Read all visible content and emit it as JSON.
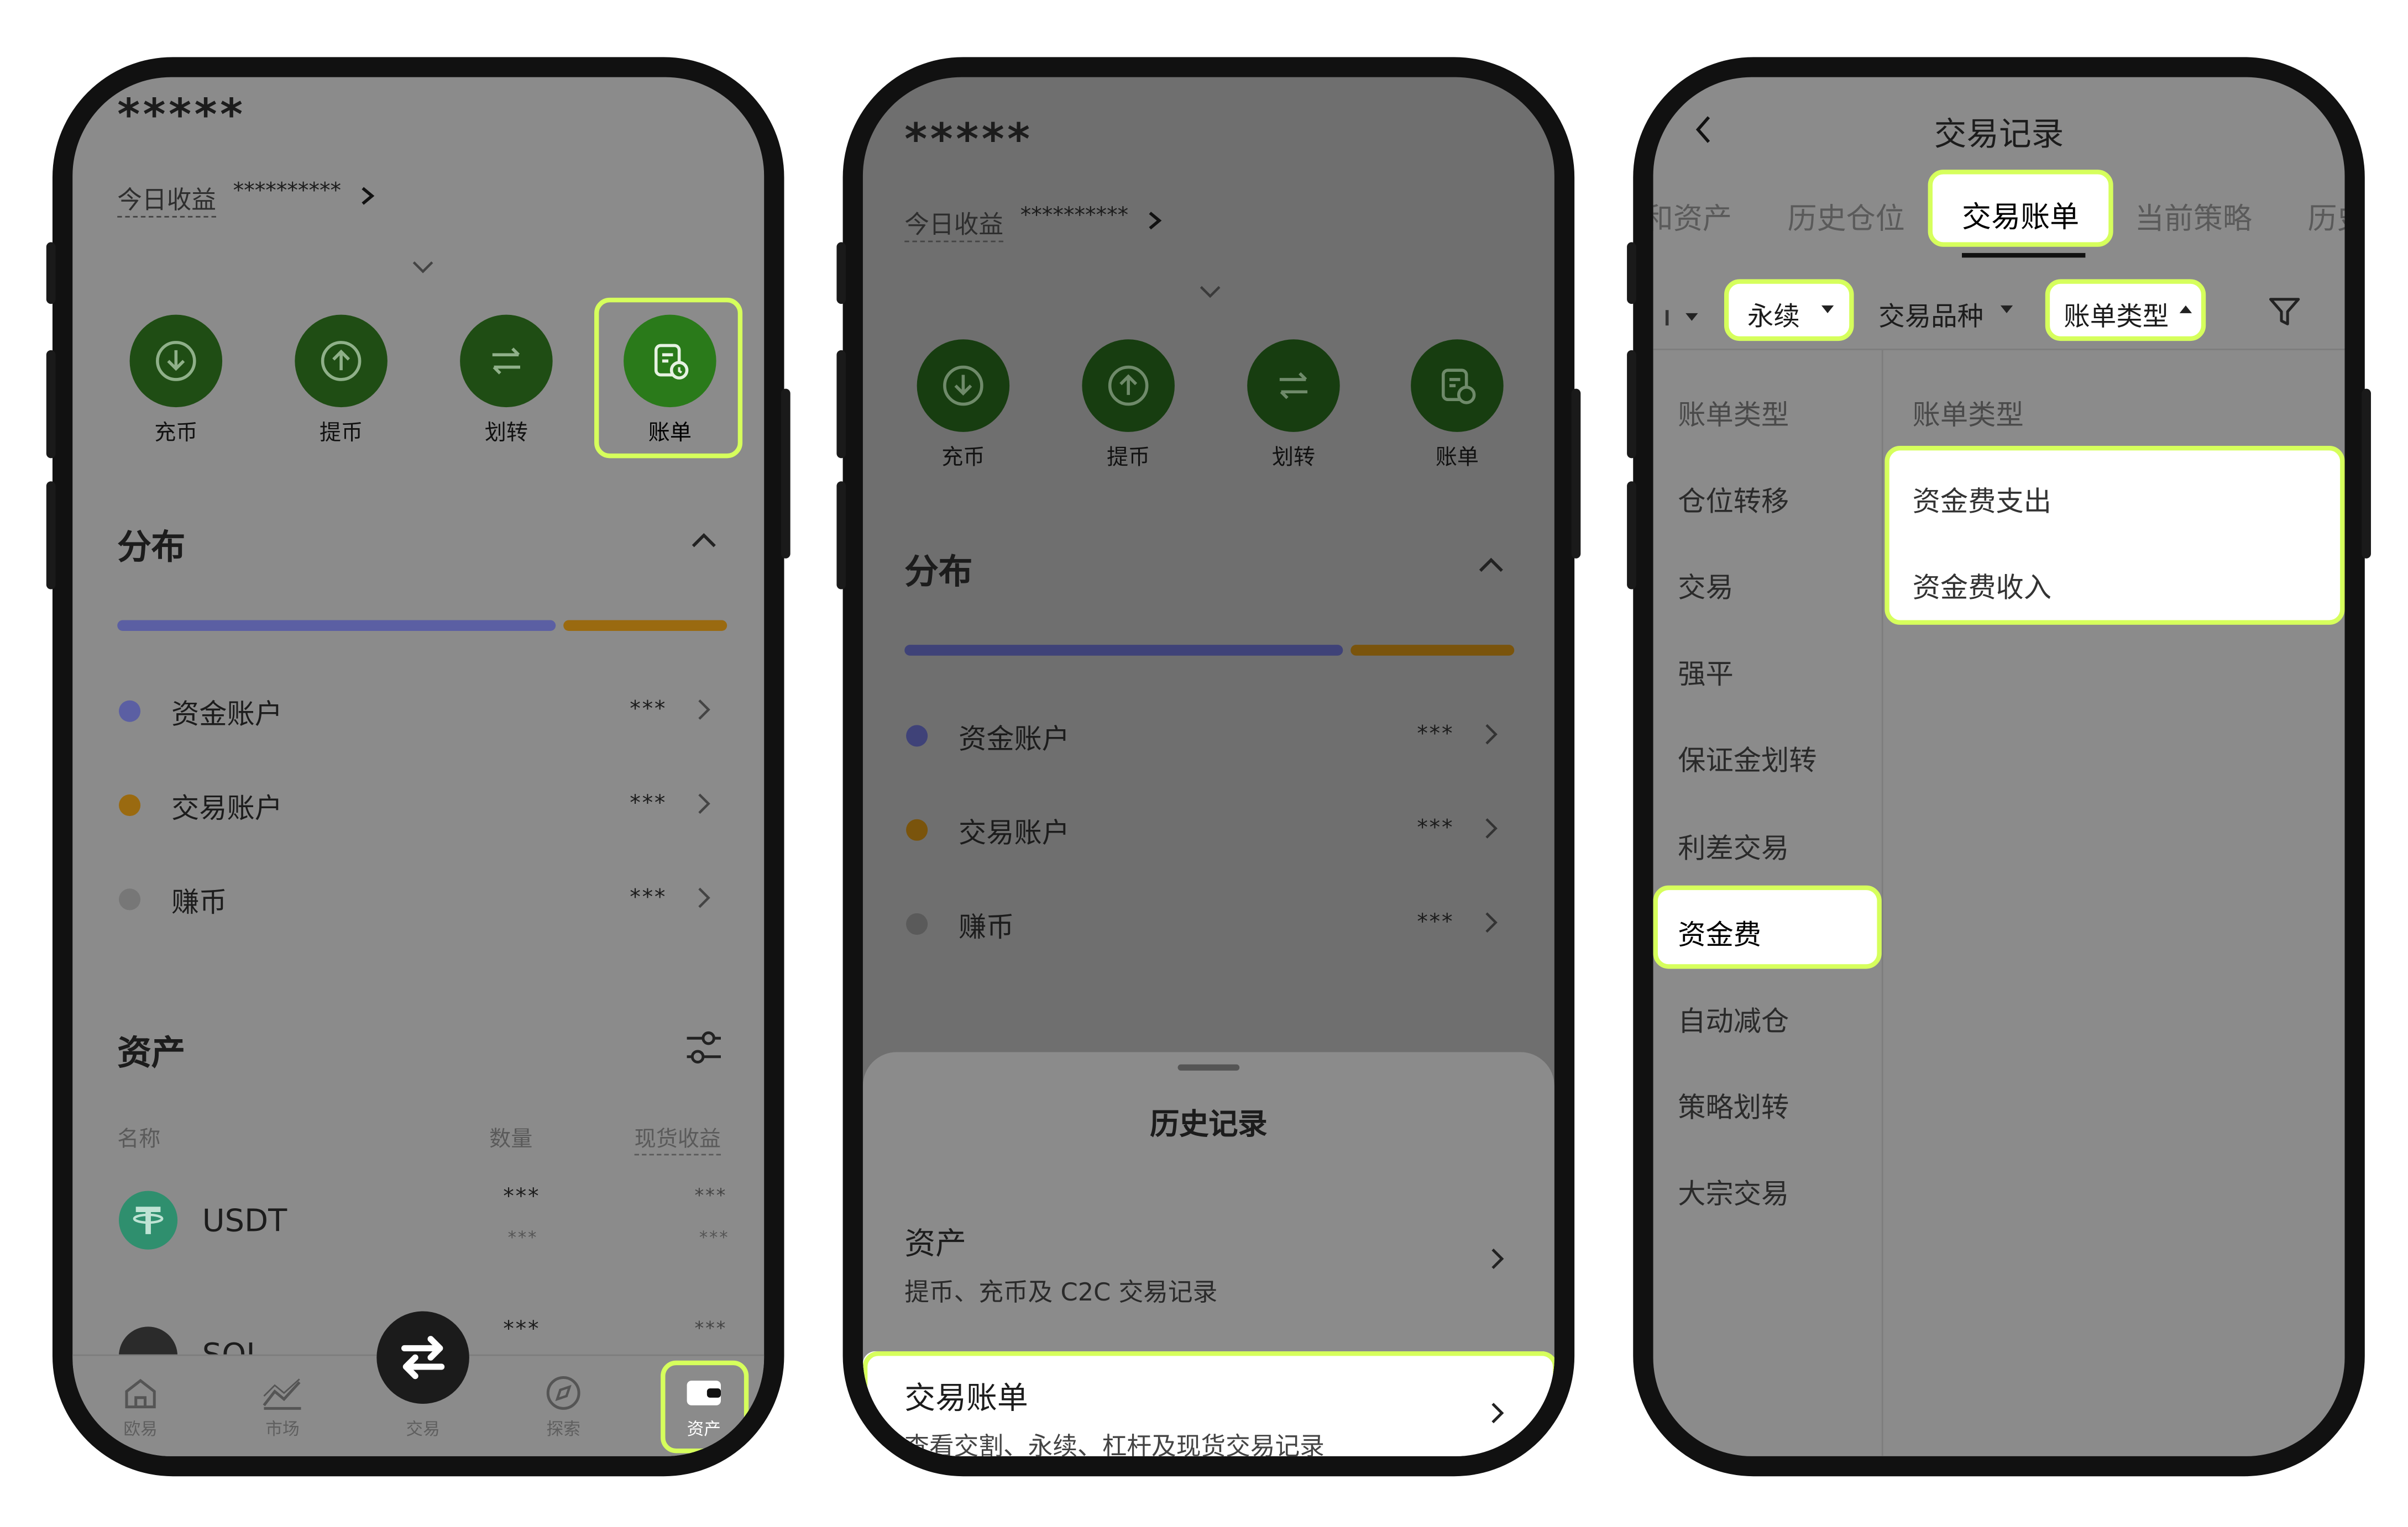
{
  "colors": {
    "highlight": "#d6ff5c",
    "screen_gray": "#8b8b8b",
    "action_green": "#1f4d14",
    "funding_account": "#5b5fa3",
    "trading_account": "#9a6a10",
    "earn": "#777777",
    "usdt_green": "#2f8f6e"
  },
  "phone1": {
    "balance_mask": "*****",
    "today_pnl_label": "今日收益",
    "today_pnl_value": "**********",
    "actions": [
      {
        "label": "充币",
        "icon": "deposit-icon"
      },
      {
        "label": "提币",
        "icon": "withdraw-icon"
      },
      {
        "label": "划转",
        "icon": "transfer-icon"
      },
      {
        "label": "账单",
        "icon": "bill-icon"
      }
    ],
    "distribution_title": "分布",
    "accounts": [
      {
        "name": "资金账户",
        "value": "***"
      },
      {
        "name": "交易账户",
        "value": "***"
      },
      {
        "name": "赚币",
        "value": "***"
      }
    ],
    "assets_title": "资产",
    "columns": {
      "name": "名称",
      "quantity": "数量",
      "pnl": "现货收益"
    },
    "coins": [
      {
        "symbol": "USDT",
        "qty": "***",
        "qty_sub": "***",
        "pnl": "***",
        "pnl_sub": "***"
      },
      {
        "symbol": "SOL",
        "qty": "***",
        "pnl": "***"
      }
    ],
    "nav": [
      {
        "label": "欧易",
        "icon": "home-icon"
      },
      {
        "label": "市场",
        "icon": "market-icon"
      },
      {
        "label": "交易",
        "icon": "trade-swap-icon"
      },
      {
        "label": "探索",
        "icon": "explore-icon"
      },
      {
        "label": "资产",
        "icon": "wallet-icon"
      }
    ]
  },
  "phone2": {
    "balance_mask": "*****",
    "today_pnl_label": "今日收益",
    "today_pnl_value": "**********",
    "actions": [
      {
        "label": "充币"
      },
      {
        "label": "提币"
      },
      {
        "label": "划转"
      },
      {
        "label": "账单"
      }
    ],
    "distribution_title": "分布",
    "accounts": [
      {
        "name": "资金账户",
        "value": "***"
      },
      {
        "name": "交易账户",
        "value": "***"
      },
      {
        "name": "赚币",
        "value": "***"
      }
    ],
    "sheet": {
      "title": "历史记录",
      "items": [
        {
          "title": "资产",
          "subtitle": "提币、充币及 C2C 交易记录"
        },
        {
          "title": "交易账单",
          "subtitle": "查看交割、永续、杠杆及现货交易记录"
        }
      ]
    }
  },
  "phone3": {
    "title": "交易记录",
    "tabs": [
      "和资产",
      "历史仓位",
      "交易账单",
      "当前策略",
      "历史"
    ],
    "active_tab": "交易账单",
    "filters": {
      "first": "永续",
      "second": "交易品种",
      "third": "账单类型"
    },
    "left_header": "账单类型",
    "categories": [
      "仓位转移",
      "交易",
      "强平",
      "保证金划转",
      "利差交易",
      "资金费",
      "自动减仓",
      "策略划转",
      "大宗交易"
    ],
    "selected_category": "资金费",
    "right_header": "账单类型",
    "sub_options": [
      "资金费支出",
      "资金费收入"
    ]
  }
}
